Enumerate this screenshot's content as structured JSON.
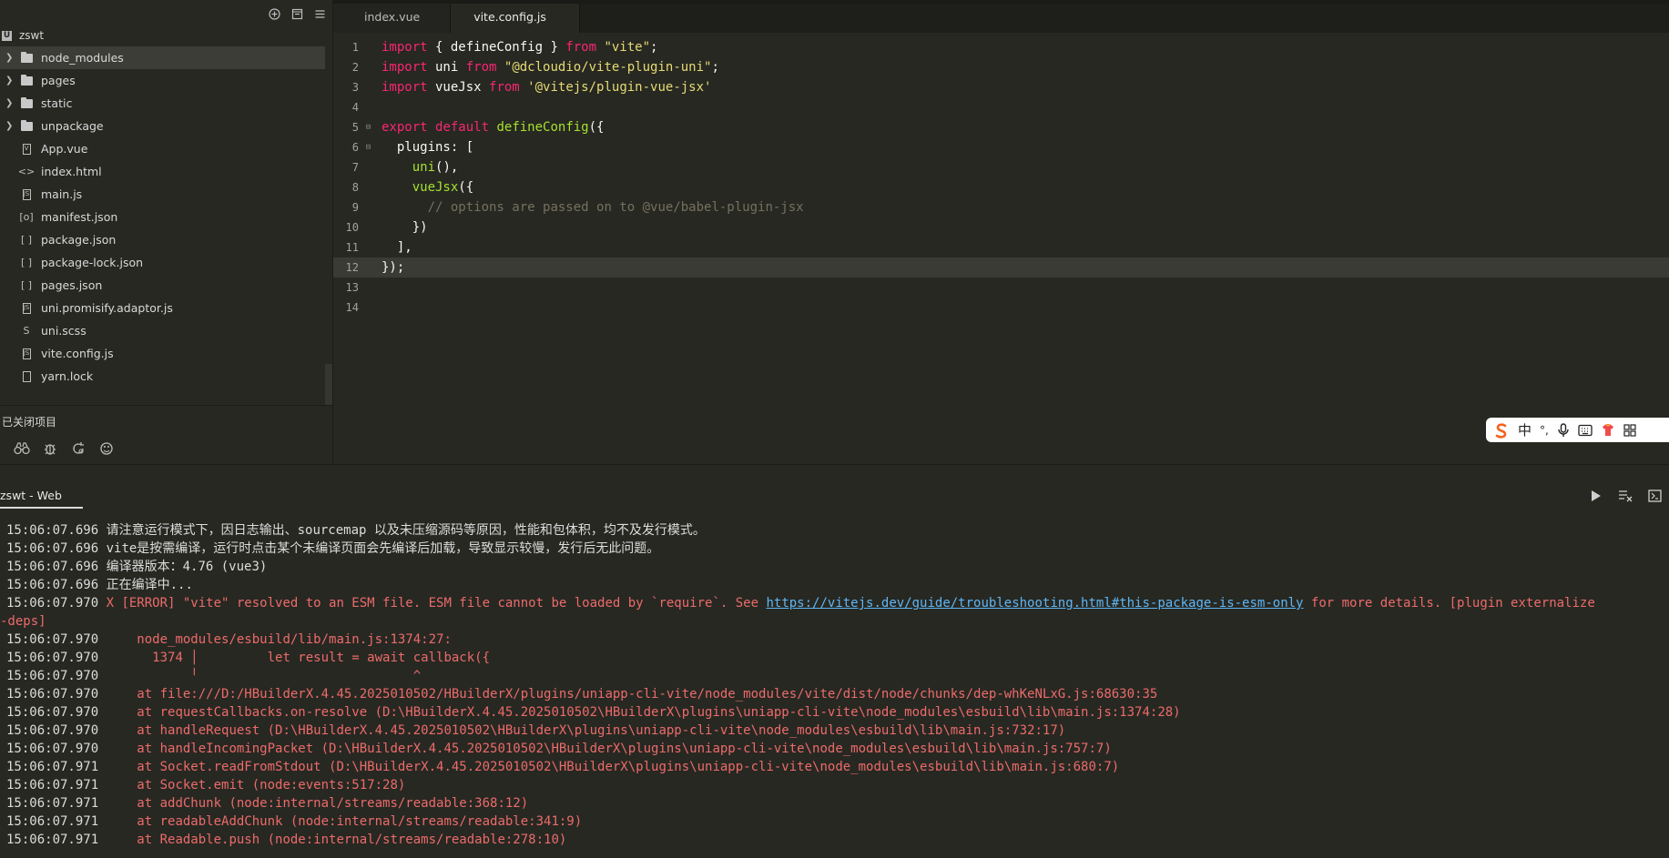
{
  "sidebar": {
    "project_icon": "U",
    "project_name": "zswt",
    "items": [
      {
        "label": "node_modules",
        "type": "folder"
      },
      {
        "label": "pages",
        "type": "folder"
      },
      {
        "label": "static",
        "type": "folder"
      },
      {
        "label": "unpackage",
        "type": "folder"
      },
      {
        "label": "App.vue",
        "type": "file",
        "glyph": "V"
      },
      {
        "label": "index.html",
        "type": "file",
        "glyph": "<>"
      },
      {
        "label": "main.js",
        "type": "file",
        "glyph": "JS"
      },
      {
        "label": "manifest.json",
        "type": "file",
        "glyph": "[o]"
      },
      {
        "label": "package.json",
        "type": "file",
        "glyph": "[ ]"
      },
      {
        "label": "package-lock.json",
        "type": "file",
        "glyph": "[ ]"
      },
      {
        "label": "pages.json",
        "type": "file",
        "glyph": "[ ]"
      },
      {
        "label": "uni.promisify.adaptor.js",
        "type": "file",
        "glyph": "JS"
      },
      {
        "label": "uni.scss",
        "type": "file",
        "glyph": "S"
      },
      {
        "label": "vite.config.js",
        "type": "file",
        "glyph": "JS"
      },
      {
        "label": "yarn.lock",
        "type": "file",
        "glyph": ""
      }
    ],
    "closed_projects_label": "已关闭项目"
  },
  "editor": {
    "tabs": [
      {
        "label": "index.vue",
        "active": false
      },
      {
        "label": "vite.config.js",
        "active": true
      }
    ],
    "lines": [
      {
        "n": "1",
        "tokens": [
          [
            "kw",
            "import"
          ],
          [
            "pl",
            " { defineConfig } "
          ],
          [
            "kw",
            "from"
          ],
          [
            "pl",
            " "
          ],
          [
            "str",
            "\"vite\""
          ],
          [
            "pl",
            ";"
          ]
        ]
      },
      {
        "n": "2",
        "tokens": [
          [
            "kw",
            "import"
          ],
          [
            "pl",
            " uni "
          ],
          [
            "kw",
            "from"
          ],
          [
            "pl",
            " "
          ],
          [
            "str",
            "\"@dcloudio/vite-plugin-uni\""
          ],
          [
            "pl",
            ";"
          ]
        ]
      },
      {
        "n": "3",
        "tokens": [
          [
            "kw",
            "import"
          ],
          [
            "pl",
            " vueJsx "
          ],
          [
            "kw",
            "from"
          ],
          [
            "pl",
            " "
          ],
          [
            "str",
            "'@vitejs/plugin-vue-jsx'"
          ]
        ]
      },
      {
        "n": "4",
        "tokens": []
      },
      {
        "n": "5",
        "fold": true,
        "tokens": [
          [
            "kw",
            "export"
          ],
          [
            "pl",
            " "
          ],
          [
            "kw",
            "default"
          ],
          [
            "pl",
            " "
          ],
          [
            "fn",
            "defineConfig"
          ],
          [
            "pl",
            "({"
          ]
        ]
      },
      {
        "n": "6",
        "fold": true,
        "tokens": [
          [
            "pl",
            "  plugins: ["
          ]
        ]
      },
      {
        "n": "7",
        "tokens": [
          [
            "pl",
            "    "
          ],
          [
            "fn",
            "uni"
          ],
          [
            "pl",
            "(),"
          ]
        ]
      },
      {
        "n": "8",
        "tokens": [
          [
            "pl",
            "    "
          ],
          [
            "fn",
            "vueJsx"
          ],
          [
            "pl",
            "({"
          ]
        ]
      },
      {
        "n": "9",
        "tokens": [
          [
            "pl",
            "      "
          ],
          [
            "cm",
            "// options are passed on to @vue/babel-plugin-jsx"
          ]
        ]
      },
      {
        "n": "10",
        "tokens": [
          [
            "pl",
            "    })"
          ]
        ]
      },
      {
        "n": "11",
        "tokens": [
          [
            "pl",
            "  ],"
          ]
        ]
      },
      {
        "n": "12",
        "current": true,
        "tokens": [
          [
            "pl",
            "});"
          ]
        ]
      },
      {
        "n": "13",
        "tokens": []
      },
      {
        "n": "14",
        "tokens": []
      }
    ]
  },
  "ime": {
    "chinese": "中",
    "punct": "°,"
  },
  "console": {
    "tab_label": "zswt - Web",
    "lines": [
      {
        "ts": "15:06:07.696",
        "msg": " 请注意运行模式下，因日志输出、sourcemap 以及未压缩源码等原因，性能和包体积，均不及发行模式。"
      },
      {
        "ts": "15:06:07.696",
        "msg": " vite是按需编译，运行时点击某个未编译页面会先编译后加载，导致显示较慢，发行后无此问题。"
      },
      {
        "ts": "15:06:07.696",
        "msg": " 编译器版本：4.76 (vue3)"
      },
      {
        "ts": "15:06:07.696",
        "msg": " 正在编译中..."
      },
      {
        "ts": "15:06:07.970",
        "err": true,
        "msg": " X [ERROR] \"vite\" resolved to an ESM file. ESM file cannot be loaded by `require`. See ",
        "link": "https://vitejs.dev/guide/troubleshooting.html#this-package-is-esm-only",
        "msg_after": " for more details. [plugin externalize"
      },
      {
        "ts": "",
        "err": true,
        "msg": "-deps]"
      },
      {
        "ts": "15:06:07.970",
        "err": true,
        "msg": "     node_modules/esbuild/lib/main.js:1374:27:"
      },
      {
        "ts": "15:06:07.970",
        "err": true,
        "msg": "       1374 │         let result = await callback({"
      },
      {
        "ts": "15:06:07.970",
        "err": true,
        "msg": "            ╵                            ^"
      },
      {
        "ts": "15:06:07.970",
        "err": true,
        "msg": "     at file:///D:/HBuilderX.4.45.2025010502/HBuilderX/plugins/uniapp-cli-vite/node_modules/vite/dist/node/chunks/dep-whKeNLxG.js:68630:35"
      },
      {
        "ts": "15:06:07.970",
        "err": true,
        "msg": "     at requestCallbacks.on-resolve (D:\\HBuilderX.4.45.2025010502\\HBuilderX\\plugins\\uniapp-cli-vite\\node_modules\\esbuild\\lib\\main.js:1374:28)"
      },
      {
        "ts": "15:06:07.970",
        "err": true,
        "msg": "     at handleRequest (D:\\HBuilderX.4.45.2025010502\\HBuilderX\\plugins\\uniapp-cli-vite\\node_modules\\esbuild\\lib\\main.js:732:17)"
      },
      {
        "ts": "15:06:07.970",
        "err": true,
        "msg": "     at handleIncomingPacket (D:\\HBuilderX.4.45.2025010502\\HBuilderX\\plugins\\uniapp-cli-vite\\node_modules\\esbuild\\lib\\main.js:757:7)"
      },
      {
        "ts": "15:06:07.971",
        "err": true,
        "msg": "     at Socket.readFromStdout (D:\\HBuilderX.4.45.2025010502\\HBuilderX\\plugins\\uniapp-cli-vite\\node_modules\\esbuild\\lib\\main.js:680:7)"
      },
      {
        "ts": "15:06:07.971",
        "err": true,
        "msg": "     at Socket.emit (node:events:517:28)"
      },
      {
        "ts": "15:06:07.971",
        "err": true,
        "msg": "     at addChunk (node:internal/streams/readable:368:12)"
      },
      {
        "ts": "15:06:07.971",
        "err": true,
        "msg": "     at readableAddChunk (node:internal/streams/readable:341:9)"
      },
      {
        "ts": "15:06:07.971",
        "err": true,
        "msg": "     at Readable.push (node:internal/streams/readable:278:10)"
      }
    ]
  }
}
